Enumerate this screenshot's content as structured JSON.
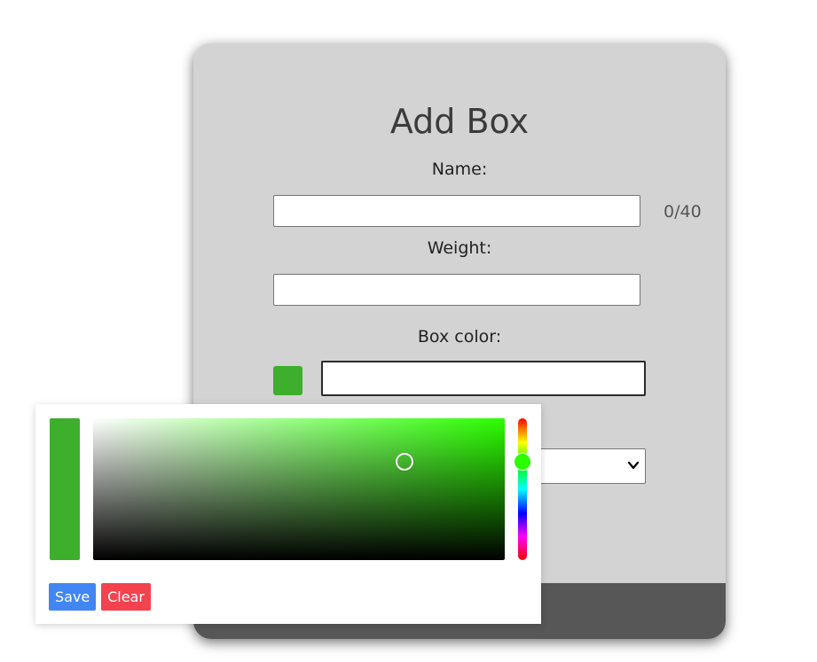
{
  "form": {
    "title": "Add Box",
    "name_label": "Name:",
    "name_value": "",
    "name_counter": "0/40",
    "weight_label": "Weight:",
    "weight_value": "",
    "color_label": "Box color:",
    "color_value": "",
    "swatch_color": "#3daf2c"
  },
  "picker": {
    "preview_color": "#3daf2c",
    "hue_color": "#2bff00",
    "save_label": "Save",
    "clear_label": "Clear",
    "save_color": "#4286f4",
    "clear_color": "#f4424f"
  },
  "colors": {
    "card_bg": "#d3d3d3",
    "footer_bg": "#575757"
  },
  "icons": {
    "select_chevron": "chevron-down-icon"
  }
}
